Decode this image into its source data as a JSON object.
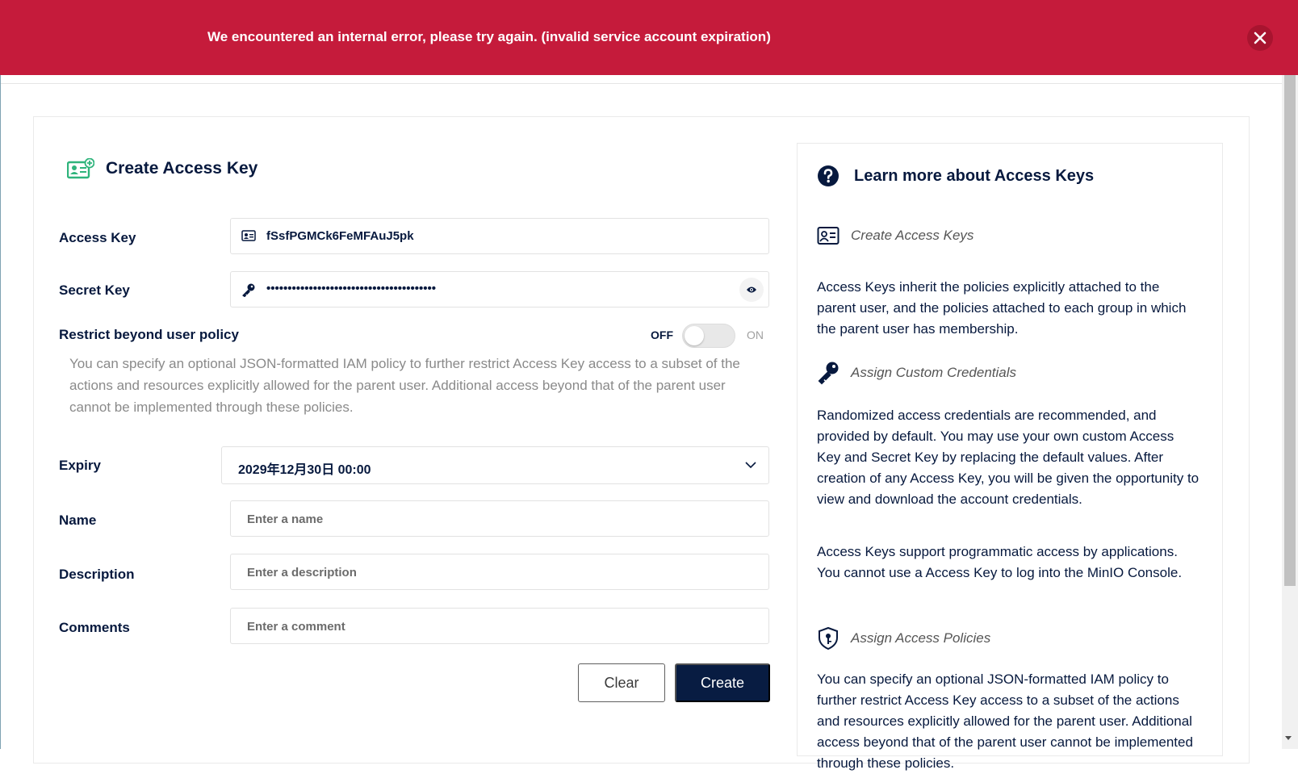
{
  "error": {
    "message": "We encountered an internal error, please try again. (invalid service account expiration)",
    "close_symbol": "✕"
  },
  "form": {
    "title": "Create Access Key",
    "title_icon": "access-key-icon",
    "access_key": {
      "label": "Access Key",
      "value": "fSsfPGMCk6FeMFAuJ5pk",
      "icon": "id-card-icon"
    },
    "secret_key": {
      "label": "Secret Key",
      "value": "••••••••••••••••••••••••••••••••••••••••",
      "icon": "key-icon"
    },
    "restrict": {
      "label": "Restrict beyond user policy",
      "off_label": "OFF",
      "on_label": "ON",
      "enabled": false,
      "help": "You can specify an optional JSON-formatted IAM policy to further restrict Access Key access to a subset of the actions and resources explicitly allowed for the parent user. Additional access beyond that of the parent user cannot be implemented through these policies."
    },
    "expiry": {
      "label": "Expiry",
      "value": "2029年12月30日 00:00"
    },
    "name": {
      "label": "Name",
      "placeholder": "Enter a name",
      "value": ""
    },
    "description": {
      "label": "Description",
      "placeholder": "Enter a description",
      "value": ""
    },
    "comments": {
      "label": "Comments",
      "placeholder": "Enter a comment",
      "value": ""
    },
    "clear_label": "Clear",
    "create_label": "Create"
  },
  "help": {
    "title": "Learn more about Access Keys",
    "sections": [
      {
        "title": "Create Access Keys",
        "icon": "id-card-icon",
        "paragraphs": [
          "Access Keys inherit the policies explicitly attached to the parent user, and the policies attached to each group in which the parent user has membership."
        ]
      },
      {
        "title": "Assign Custom Credentials",
        "icon": "key-icon",
        "paragraphs": [
          "Randomized access credentials are recommended, and provided by default. You may use your own custom Access Key and Secret Key by replacing the default values. After creation of any Access Key, you will be given the opportunity to view and download the account credentials.",
          "Access Keys support programmatic access by applications. You cannot use a Access Key to log into the MinIO Console."
        ]
      },
      {
        "title": "Assign Access Policies",
        "icon": "shield-icon",
        "paragraphs": [
          "You can specify an optional JSON-formatted IAM policy to further restrict Access Key access to a subset of the actions and resources explicitly allowed for the parent user. Additional access beyond that of the parent user cannot be implemented through these policies."
        ]
      }
    ]
  },
  "colors": {
    "error_bg": "#c51b3b",
    "primary": "#081c42",
    "accent_green": "#2fb47c"
  }
}
